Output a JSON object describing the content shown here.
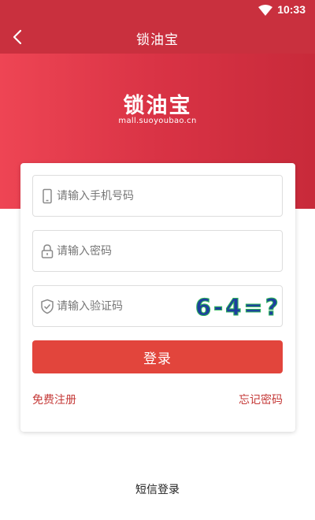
{
  "status_bar": {
    "time": "10:33",
    "wifi_icon": "wifi-icon"
  },
  "app_bar": {
    "title": "锁油宝",
    "back_icon": "chevron-left-icon"
  },
  "logo": {
    "brand": "锁油宝",
    "domain": "mall.suoyoubao.cn"
  },
  "form": {
    "phone_placeholder": "请输入手机号码",
    "password_placeholder": "请输入密码",
    "captcha_placeholder": "请输入验证码",
    "captcha_text": "6-4=?",
    "login_label": "登录",
    "register_label": "免费注册",
    "forgot_label": "忘记密码"
  },
  "footer": {
    "sms_login_label": "短信登录"
  },
  "colors": {
    "primary": "#c9303e",
    "button": "#e2453c",
    "link": "#c53a38"
  }
}
